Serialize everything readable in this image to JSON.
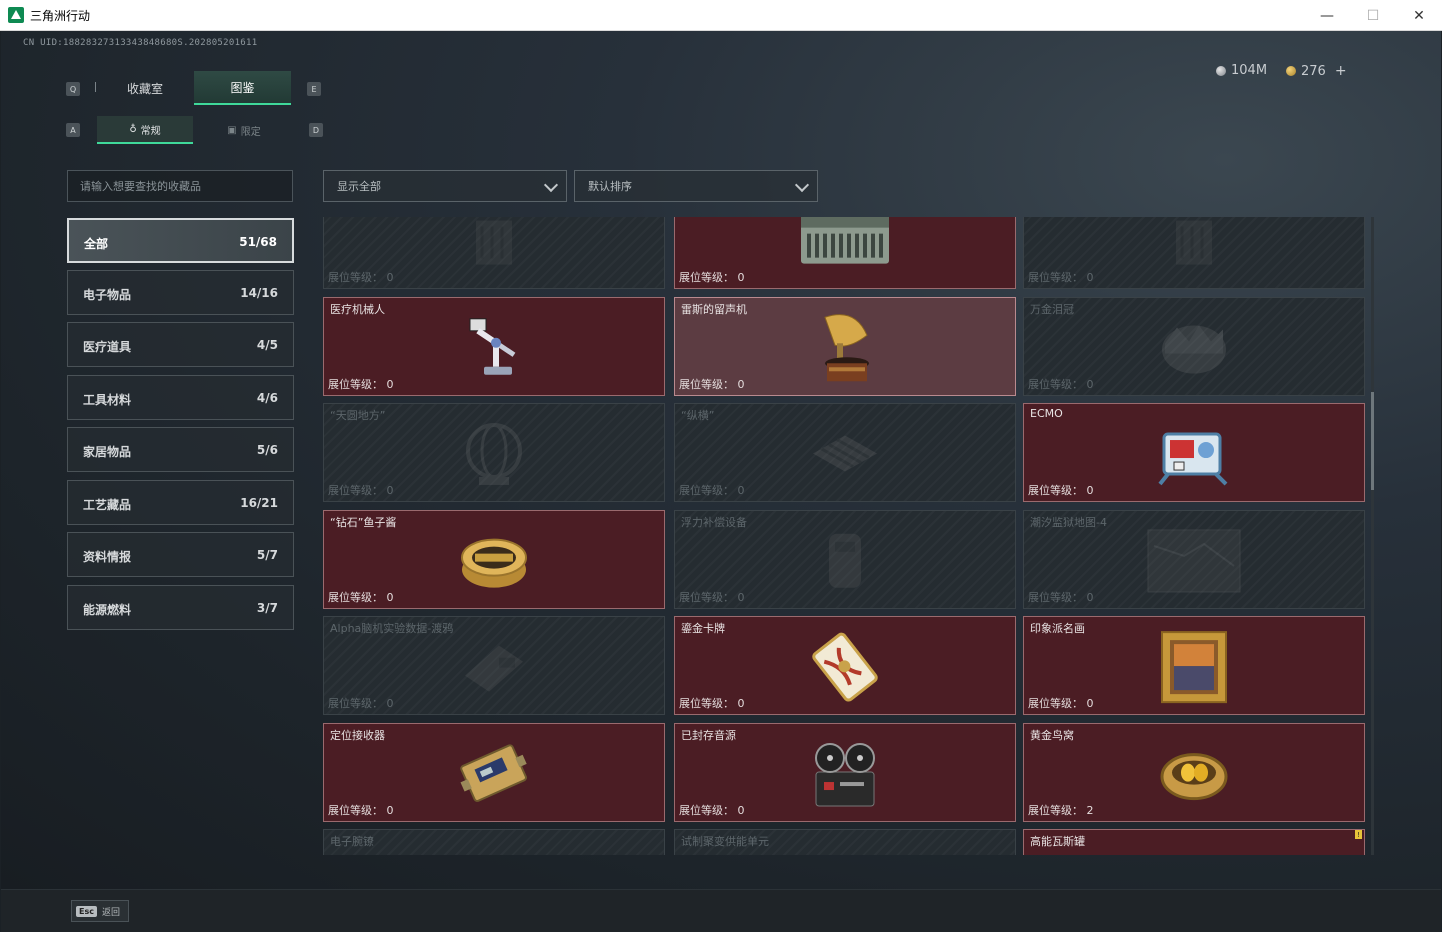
{
  "window": {
    "title": "三角洲行动",
    "minimize": "—",
    "maximize": "☐",
    "close": "✕"
  },
  "uid": "CN UID:18828327313343848680S.202805201611",
  "currency": {
    "silver": "104M",
    "gold": "276",
    "plus": "+"
  },
  "keys": {
    "tab_prev": "Q",
    "tab_next": "E",
    "sub_prev": "A",
    "sub_next": "D"
  },
  "tabs": [
    {
      "label": "收藏室"
    },
    {
      "label": "图鉴"
    }
  ],
  "subtabs": [
    {
      "label": "常规"
    },
    {
      "label": "限定"
    }
  ],
  "search": {
    "placeholder": "请输入想要查找的收藏品"
  },
  "filters": {
    "show": "显示全部",
    "sort": "默认排序"
  },
  "categories": [
    {
      "name": "全部",
      "count": "51/68"
    },
    {
      "name": "电子物品",
      "count": "14/16"
    },
    {
      "name": "医疗道具",
      "count": "4/5"
    },
    {
      "name": "工具材料",
      "count": "4/6"
    },
    {
      "name": "家居物品",
      "count": "5/6"
    },
    {
      "name": "工艺藏品",
      "count": "16/21"
    },
    {
      "name": "资料情报",
      "count": "5/7"
    },
    {
      "name": "能源燃料",
      "count": "3/7"
    }
  ],
  "level_label": "展位等级：",
  "cards": [
    {
      "name": "",
      "level": "0",
      "state": "locked",
      "icon": "locked-item-icon"
    },
    {
      "name": "",
      "level": "0",
      "state": "owned",
      "icon": "server-case-icon"
    },
    {
      "name": "",
      "level": "0",
      "state": "locked",
      "icon": "locked-item-icon"
    },
    {
      "name": "医疗机械人",
      "level": "0",
      "state": "owned",
      "icon": "medical-robot-icon"
    },
    {
      "name": "雷斯的留声机",
      "level": "0",
      "state": "selected",
      "icon": "gramophone-icon"
    },
    {
      "name": "万金泪冠",
      "level": "0",
      "state": "locked",
      "icon": "crown-icon"
    },
    {
      "name": "“天圆地方”",
      "level": "0",
      "state": "locked",
      "icon": "globe-icon"
    },
    {
      "name": "“纵横”",
      "level": "0",
      "state": "locked",
      "icon": "chessboard-icon"
    },
    {
      "name": "ECMO",
      "level": "0",
      "state": "owned",
      "icon": "ecmo-machine-icon"
    },
    {
      "name": "“钻石”鱼子酱",
      "level": "0",
      "state": "owned",
      "icon": "caviar-tin-icon"
    },
    {
      "name": "浮力补偿设备",
      "level": "0",
      "state": "locked",
      "icon": "buoyancy-device-icon"
    },
    {
      "name": "潮汐监狱地图-4",
      "level": "0",
      "state": "locked",
      "icon": "map-icon"
    },
    {
      "name": "Alpha脑机实验数据-渡鸦",
      "level": "0",
      "state": "locked",
      "icon": "data-drive-icon"
    },
    {
      "name": "鎏金卡牌",
      "level": "0",
      "state": "owned",
      "icon": "gold-card-icon"
    },
    {
      "name": "印象派名画",
      "level": "0",
      "state": "owned",
      "icon": "painting-icon"
    },
    {
      "name": "定位接收器",
      "level": "0",
      "state": "owned",
      "icon": "gps-receiver-icon"
    },
    {
      "name": "已封存音源",
      "level": "0",
      "state": "owned",
      "icon": "reel-recorder-icon"
    },
    {
      "name": "黄金鸟窝",
      "level": "2",
      "state": "owned",
      "icon": "golden-nest-icon"
    },
    {
      "name": "电子腕镣",
      "level": "",
      "state": "locked",
      "icon": "wrist-device-icon"
    },
    {
      "name": "试制聚变供能单元",
      "level": "",
      "state": "locked",
      "icon": "fusion-cell-icon"
    },
    {
      "name": "高能瓦斯罐",
      "level": "",
      "state": "owned",
      "icon": "gas-tank-icon",
      "badge": "!"
    }
  ],
  "footer": {
    "esc_key": "Esc",
    "back": "返回"
  }
}
